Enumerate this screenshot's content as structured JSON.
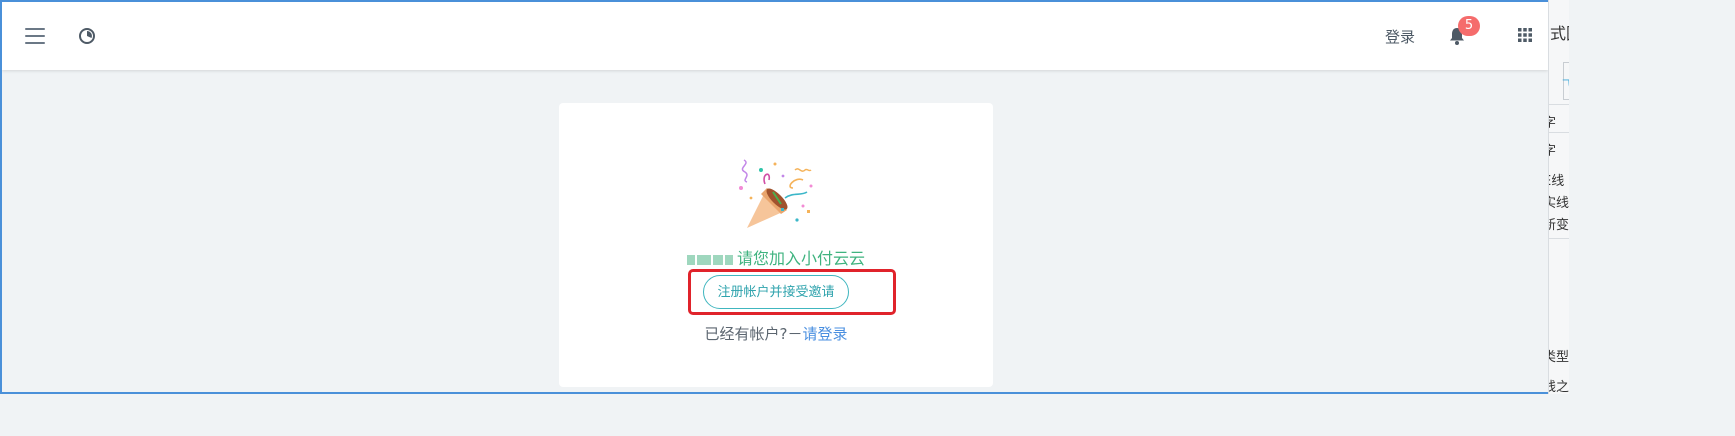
{
  "topbar": {
    "menu_icon": "hamburger-menu-icon",
    "logo_icon": "logo-icon",
    "login_label": "登录",
    "bell_icon": "bell-icon",
    "notification_count": "5",
    "apps_icon": "grid-apps-icon"
  },
  "invite": {
    "illustration": "party-popper-icon",
    "message": "请您加入小付云云",
    "signup_button": "注册帐户并接受邀请",
    "has_account_text": "已经有帐户?－",
    "login_link": "请登录"
  },
  "colors": {
    "accent_green": "#3fb37f",
    "button_teal": "#2fa3ad",
    "link_blue": "#4a8fe0",
    "highlight_red": "#e0232b",
    "badge_red": "#f56c6c",
    "frame_blue": "#4a90d9"
  },
  "side_panel": {
    "lines": [
      "式图",
      "飞",
      "字",
      "E线",
      "实线",
      "新变",
      "类型",
      "线之"
    ]
  }
}
